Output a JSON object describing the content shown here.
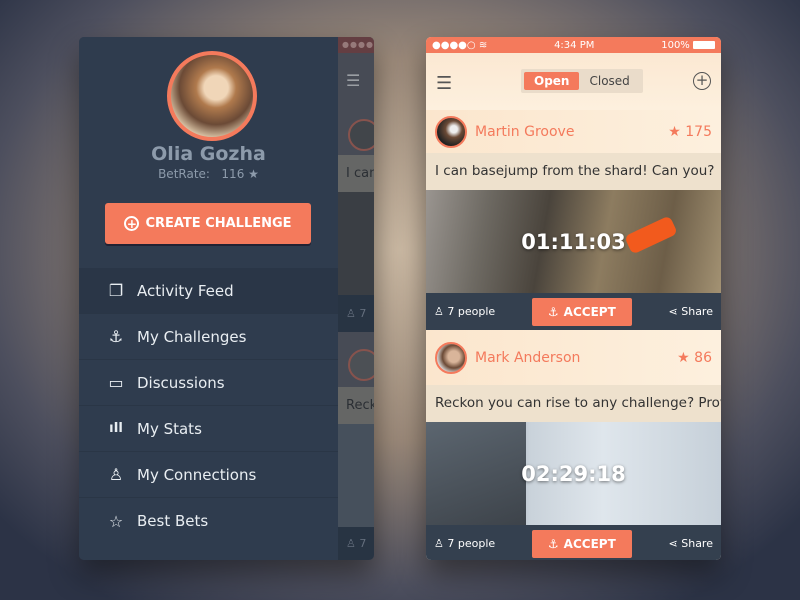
{
  "sidebar": {
    "user_name": "Olia Gozha",
    "betrate_label": "BetRate:",
    "betrate_value": "116 ★",
    "create_label": "CREATE CHALLENGE",
    "items": [
      {
        "label": "Activity Feed",
        "icon": "copy-icon",
        "glyph": "❐"
      },
      {
        "label": "My Challenges",
        "icon": "anchor-icon",
        "glyph": "⚓"
      },
      {
        "label": "Discussions",
        "icon": "speech-bubble-icon",
        "glyph": "▭"
      },
      {
        "label": "My Stats",
        "icon": "bar-stats-icon",
        "glyph": "ıIl"
      },
      {
        "label": "My Connections",
        "icon": "user-icon",
        "glyph": "♙"
      },
      {
        "label": "Best Bets",
        "icon": "star-icon",
        "glyph": "☆"
      }
    ],
    "peek": {
      "text1": "I can",
      "text2": "Reck",
      "people": "7"
    }
  },
  "status": {
    "signal": "●●●●○",
    "time": "4:34 PM",
    "battery": "100%"
  },
  "header": {
    "tab_open": "Open",
    "tab_closed": "Closed"
  },
  "cards": [
    {
      "name": "Martin Groove",
      "rating": "★ 175",
      "text": "I can basejump from the shard! Can you?",
      "timer": "01:11:03",
      "people": "7 people",
      "accept": "ACCEPT",
      "share": "Share"
    },
    {
      "name": "Mark Anderson",
      "rating": "★ 86",
      "text": "Reckon you can rise to any challenge? Prove it",
      "timer": "02:29:18",
      "people": "7 people",
      "accept": "ACCEPT",
      "share": "Share"
    }
  ],
  "colors": {
    "accent": "#f47a5c",
    "sidebar": "#2f3c4e",
    "footer": "#34404f"
  }
}
